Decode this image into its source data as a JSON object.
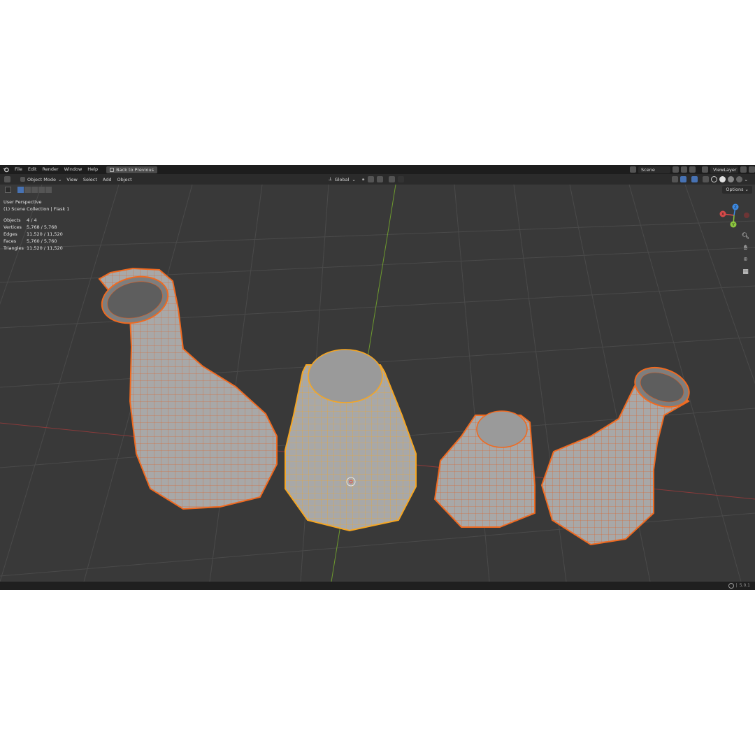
{
  "menu": [
    "File",
    "Edit",
    "Render",
    "Window",
    "Help"
  ],
  "back_button": "Back to Previous",
  "scene": "Scene",
  "view_layer": "ViewLayer",
  "header": {
    "mode": "Object Mode",
    "menus": [
      "View",
      "Select",
      "Add",
      "Object"
    ],
    "transform_orientation": "Global"
  },
  "options_label": "Options",
  "overlay": {
    "view_name": "User Perspective",
    "collection": "(1) Scene Collection | Flask 1",
    "stats": [
      {
        "label": "Objects",
        "value": "4 / 4"
      },
      {
        "label": "Vertices",
        "value": "5,768 / 5,768"
      },
      {
        "label": "Edges",
        "value": "11,520 / 11,520"
      },
      {
        "label": "Faces",
        "value": "5,760 / 5,760"
      },
      {
        "label": "Triangles",
        "value": "11,520 / 11,520"
      }
    ]
  },
  "gizmo": {
    "x": "X",
    "y": "Y",
    "z": "Z"
  },
  "version": "5.0.1",
  "colors": {
    "selected": "#f06a20",
    "active": "#f5a623",
    "axis_x": "#d84a4a",
    "axis_y": "#8cc63f",
    "axis_z": "#3d8be5"
  },
  "objects": [
    {
      "name": "flask-large-left",
      "state": "selected"
    },
    {
      "name": "cone-front-center",
      "state": "active"
    },
    {
      "name": "cone-small-right",
      "state": "selected"
    },
    {
      "name": "flask-right",
      "state": "selected"
    }
  ]
}
